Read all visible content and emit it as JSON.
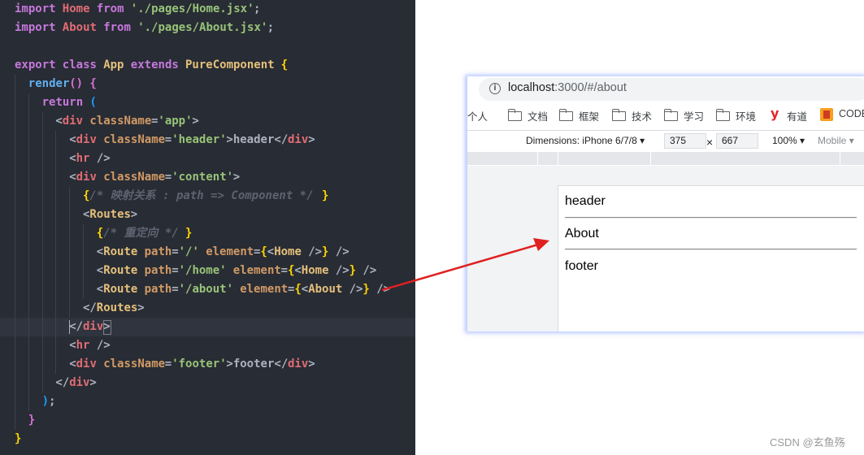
{
  "editor": {
    "lines": [
      [
        {
          "t": "import",
          "c": "kw"
        },
        {
          "t": " "
        },
        {
          "t": "Home",
          "c": "tag"
        },
        {
          "t": " "
        },
        {
          "t": "from",
          "c": "kw"
        },
        {
          "t": " "
        },
        {
          "t": "'./pages/Home.jsx'",
          "c": "str"
        },
        {
          "t": ";",
          "c": "pl"
        }
      ],
      [
        {
          "t": "import",
          "c": "kw"
        },
        {
          "t": " "
        },
        {
          "t": "About",
          "c": "tag"
        },
        {
          "t": " "
        },
        {
          "t": "from",
          "c": "kw"
        },
        {
          "t": " "
        },
        {
          "t": "'./pages/About.jsx'",
          "c": "str"
        },
        {
          "t": ";",
          "c": "pl"
        }
      ],
      [],
      [
        {
          "t": "export",
          "c": "kw"
        },
        {
          "t": " "
        },
        {
          "t": "class",
          "c": "kw"
        },
        {
          "t": " "
        },
        {
          "t": "App",
          "c": "cls"
        },
        {
          "t": " "
        },
        {
          "t": "extends",
          "c": "kw"
        },
        {
          "t": " "
        },
        {
          "t": "PureComponent",
          "c": "cls"
        },
        {
          "t": " "
        },
        {
          "t": "{",
          "c": "bry"
        }
      ],
      [
        {
          "t": "  "
        },
        {
          "t": "render",
          "c": "fn"
        },
        {
          "t": "()",
          "c": "brp"
        },
        {
          "t": " "
        },
        {
          "t": "{",
          "c": "brp"
        }
      ],
      [
        {
          "t": "    "
        },
        {
          "t": "return",
          "c": "kw"
        },
        {
          "t": " "
        },
        {
          "t": "(",
          "c": "brb"
        }
      ],
      [
        {
          "t": "      "
        },
        {
          "t": "<",
          "c": "pl"
        },
        {
          "t": "div",
          "c": "tag"
        },
        {
          "t": " "
        },
        {
          "t": "className",
          "c": "atr"
        },
        {
          "t": "=",
          "c": "pl"
        },
        {
          "t": "'app'",
          "c": "str"
        },
        {
          "t": ">",
          "c": "pl"
        }
      ],
      [
        {
          "t": "        "
        },
        {
          "t": "<",
          "c": "pl"
        },
        {
          "t": "div",
          "c": "tag"
        },
        {
          "t": " "
        },
        {
          "t": "className",
          "c": "atr"
        },
        {
          "t": "=",
          "c": "pl"
        },
        {
          "t": "'header'",
          "c": "str"
        },
        {
          "t": ">header</",
          "c": "pl"
        },
        {
          "t": "div",
          "c": "tag"
        },
        {
          "t": ">",
          "c": "pl"
        }
      ],
      [
        {
          "t": "        "
        },
        {
          "t": "<",
          "c": "pl"
        },
        {
          "t": "hr",
          "c": "tag"
        },
        {
          "t": " />",
          "c": "pl"
        }
      ],
      [
        {
          "t": "        "
        },
        {
          "t": "<",
          "c": "pl"
        },
        {
          "t": "div",
          "c": "tag"
        },
        {
          "t": " "
        },
        {
          "t": "className",
          "c": "atr"
        },
        {
          "t": "=",
          "c": "pl"
        },
        {
          "t": "'content'",
          "c": "str"
        },
        {
          "t": ">",
          "c": "pl"
        }
      ],
      [
        {
          "t": "          "
        },
        {
          "t": "{",
          "c": "bry"
        },
        {
          "t": "/* 映射关系 : path => Component */",
          "c": "cmt"
        },
        {
          "t": "}",
          "c": "bry"
        }
      ],
      [
        {
          "t": "          "
        },
        {
          "t": "<",
          "c": "pl"
        },
        {
          "t": "Routes",
          "c": "cls"
        },
        {
          "t": ">",
          "c": "pl"
        }
      ],
      [
        {
          "t": "            "
        },
        {
          "t": "{",
          "c": "bry"
        },
        {
          "t": "/* 重定向 */",
          "c": "cmt"
        },
        {
          "t": "}",
          "c": "bry"
        }
      ],
      [
        {
          "t": "            "
        },
        {
          "t": "<",
          "c": "pl"
        },
        {
          "t": "Route",
          "c": "cls"
        },
        {
          "t": " "
        },
        {
          "t": "path",
          "c": "atr"
        },
        {
          "t": "=",
          "c": "pl"
        },
        {
          "t": "'/'",
          "c": "str"
        },
        {
          "t": " "
        },
        {
          "t": "element",
          "c": "atr"
        },
        {
          "t": "=",
          "c": "pl"
        },
        {
          "t": "{",
          "c": "bry"
        },
        {
          "t": "<",
          "c": "pl"
        },
        {
          "t": "Home",
          "c": "cls"
        },
        {
          "t": " />",
          "c": "pl"
        },
        {
          "t": "}",
          "c": "bry"
        },
        {
          "t": " />",
          "c": "pl"
        }
      ],
      [
        {
          "t": "            "
        },
        {
          "t": "<",
          "c": "pl"
        },
        {
          "t": "Route",
          "c": "cls"
        },
        {
          "t": " "
        },
        {
          "t": "path",
          "c": "atr"
        },
        {
          "t": "=",
          "c": "pl"
        },
        {
          "t": "'/home'",
          "c": "str"
        },
        {
          "t": " "
        },
        {
          "t": "element",
          "c": "atr"
        },
        {
          "t": "=",
          "c": "pl"
        },
        {
          "t": "{",
          "c": "bry"
        },
        {
          "t": "<",
          "c": "pl"
        },
        {
          "t": "Home",
          "c": "cls"
        },
        {
          "t": " />",
          "c": "pl"
        },
        {
          "t": "}",
          "c": "bry"
        },
        {
          "t": " />",
          "c": "pl"
        }
      ],
      [
        {
          "t": "            "
        },
        {
          "t": "<",
          "c": "pl"
        },
        {
          "t": "Route",
          "c": "cls"
        },
        {
          "t": " "
        },
        {
          "t": "path",
          "c": "atr"
        },
        {
          "t": "=",
          "c": "pl"
        },
        {
          "t": "'/about'",
          "c": "str"
        },
        {
          "t": " "
        },
        {
          "t": "element",
          "c": "atr"
        },
        {
          "t": "=",
          "c": "pl"
        },
        {
          "t": "{",
          "c": "bry"
        },
        {
          "t": "<",
          "c": "pl"
        },
        {
          "t": "About",
          "c": "cls"
        },
        {
          "t": " />",
          "c": "pl"
        },
        {
          "t": "}",
          "c": "bry"
        },
        {
          "t": " />",
          "c": "pl"
        }
      ],
      [
        {
          "t": "          "
        },
        {
          "t": "</",
          "c": "pl"
        },
        {
          "t": "Routes",
          "c": "cls"
        },
        {
          "t": ">",
          "c": "pl"
        }
      ],
      [
        {
          "t": "        "
        },
        {
          "t": "</",
          "c": "pl"
        },
        {
          "t": "div",
          "c": "tag"
        },
        {
          "t": ">",
          "c": "pl"
        }
      ],
      [
        {
          "t": "        "
        },
        {
          "t": "<",
          "c": "pl"
        },
        {
          "t": "hr",
          "c": "tag"
        },
        {
          "t": " />",
          "c": "pl"
        }
      ],
      [
        {
          "t": "        "
        },
        {
          "t": "<",
          "c": "pl"
        },
        {
          "t": "div",
          "c": "tag"
        },
        {
          "t": " "
        },
        {
          "t": "className",
          "c": "atr"
        },
        {
          "t": "=",
          "c": "pl"
        },
        {
          "t": "'footer'",
          "c": "str"
        },
        {
          "t": ">footer</",
          "c": "pl"
        },
        {
          "t": "div",
          "c": "tag"
        },
        {
          "t": ">",
          "c": "pl"
        }
      ],
      [
        {
          "t": "      "
        },
        {
          "t": "</",
          "c": "pl"
        },
        {
          "t": "div",
          "c": "tag"
        },
        {
          "t": ">",
          "c": "pl"
        }
      ],
      [
        {
          "t": "    "
        },
        {
          "t": ")",
          "c": "brb"
        },
        {
          "t": ";",
          "c": "pl"
        }
      ],
      [
        {
          "t": "  "
        },
        {
          "t": "}",
          "c": "brp"
        }
      ],
      [
        {
          "t": "}",
          "c": "bry"
        }
      ]
    ],
    "active_line": 17,
    "colors": {
      "background": "#282c34",
      "keyword": "#c678dd",
      "class": "#e5c07b",
      "string": "#98c379",
      "function": "#61afef",
      "tag": "#e06c75",
      "attribute": "#d19a66",
      "comment": "#5c6370"
    }
  },
  "browser": {
    "url_host": "localhost",
    "url_rest": ":3000/#/about",
    "bookmarks": [
      {
        "label": "个人",
        "icon": "none"
      },
      {
        "label": "文档",
        "icon": "folder-icon"
      },
      {
        "label": "框架",
        "icon": "folder-icon"
      },
      {
        "label": "技术",
        "icon": "folder-icon"
      },
      {
        "label": "学习",
        "icon": "folder-icon"
      },
      {
        "label": "环境",
        "icon": "folder-icon"
      },
      {
        "label": "有道",
        "icon": "youdao-icon"
      },
      {
        "label": "CODE",
        "icon": "code-icon"
      }
    ],
    "youdao_glyph": "y",
    "devtools": {
      "dimensions": "Dimensions: iPhone 6/7/8",
      "width": "375",
      "times": "×",
      "height": "667",
      "zoom": "100%",
      "throttle": "Mobile"
    },
    "page": {
      "header": "header",
      "content": "About",
      "footer": "footer"
    }
  },
  "annotation_color": "#e02020",
  "watermark": "CSDN @玄鱼殇"
}
